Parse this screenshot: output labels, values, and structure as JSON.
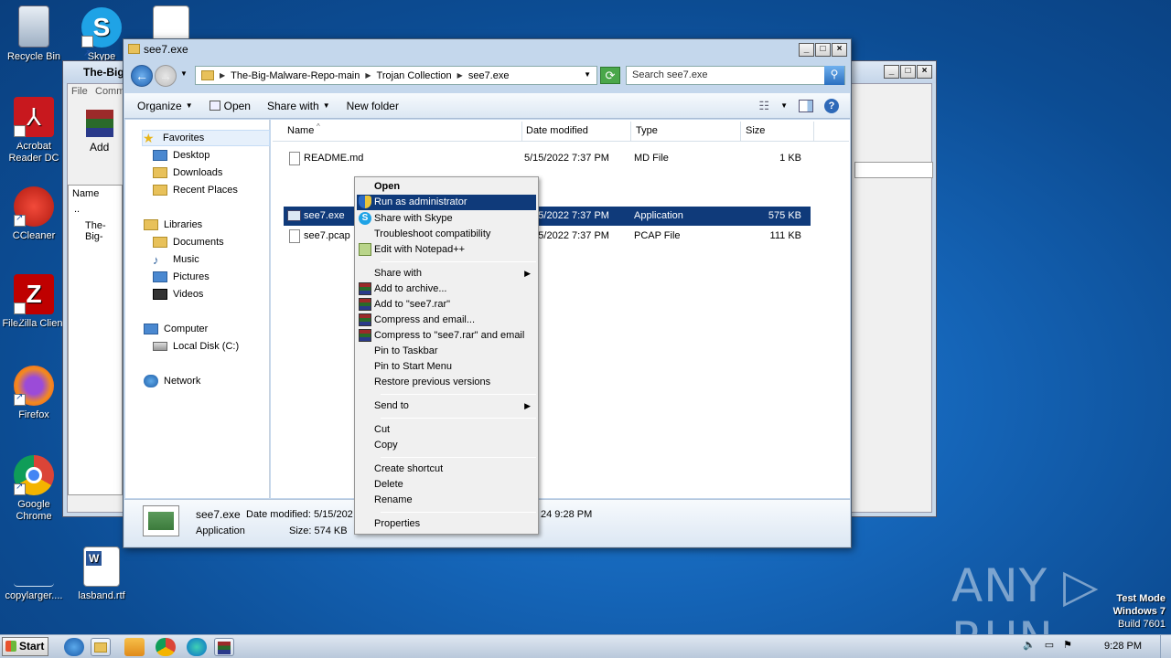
{
  "desktop": {
    "icons": [
      {
        "label": "Recycle Bin"
      },
      {
        "label": "Skype"
      },
      {
        "label": "Acrobat Reader DC"
      },
      {
        "label": "CCleaner"
      },
      {
        "label": "FileZilla Client"
      },
      {
        "label": "Firefox"
      },
      {
        "label": "Google Chrome"
      },
      {
        "label": "copylarger...."
      },
      {
        "label": "lasband.rtf"
      }
    ],
    "watermark": "ANY ▷ RUN",
    "test_mode": {
      "line1": "Test Mode",
      "line2": "Windows 7",
      "line3": "Build 7601"
    }
  },
  "back_window": {
    "title": "The-Big",
    "menu_file": "File",
    "menu_comm": "Comm",
    "add_label": "Add",
    "col_name": "Name",
    "items": [
      "..",
      "The-Big-"
    ]
  },
  "window": {
    "title": "see7.exe",
    "breadcrumb": [
      "The-Big-Malware-Repo-main",
      "Trojan Collection",
      "see7.exe"
    ],
    "search_placeholder": "Search see7.exe",
    "toolbar": {
      "organize": "Organize",
      "open": "Open",
      "share_with": "Share with",
      "new_folder": "New folder"
    },
    "nav": {
      "favorites": "Favorites",
      "desktop": "Desktop",
      "downloads": "Downloads",
      "recent": "Recent Places",
      "libraries": "Libraries",
      "documents": "Documents",
      "music": "Music",
      "pictures": "Pictures",
      "videos": "Videos",
      "computer": "Computer",
      "local_disk": "Local Disk (C:)",
      "network": "Network"
    },
    "columns": {
      "name": "Name",
      "date": "Date modified",
      "type": "Type",
      "size": "Size"
    },
    "files": [
      {
        "name": "README.md",
        "date": "5/15/2022 7:37 PM",
        "type": "MD File",
        "size": "1 KB"
      },
      {
        "name": "see7.exe",
        "date": "5/15/2022 7:37 PM",
        "type": "Application",
        "size": "575 KB"
      },
      {
        "name": "see7.pcap",
        "date": "5/15/2022 7:37 PM",
        "type": "PCAP File",
        "size": "111 KB"
      }
    ],
    "details": {
      "name": "see7.exe",
      "date_label": "Date modified: 5/15/202",
      "type": "Application",
      "size": "Size: 574 KB",
      "created_tail": "24 9:28 PM"
    }
  },
  "context_menu": {
    "items": [
      "Open",
      "Run as administrator",
      "Share with Skype",
      "Troubleshoot compatibility",
      "Edit with Notepad++",
      "Share with",
      "Add to archive...",
      "Add to \"see7.rar\"",
      "Compress and email...",
      "Compress to \"see7.rar\" and email",
      "Pin to Taskbar",
      "Pin to Start Menu",
      "Restore previous versions",
      "Send to",
      "Cut",
      "Copy",
      "Create shortcut",
      "Delete",
      "Rename",
      "Properties"
    ]
  },
  "taskbar": {
    "start": "Start",
    "clock": "9:28 PM"
  }
}
